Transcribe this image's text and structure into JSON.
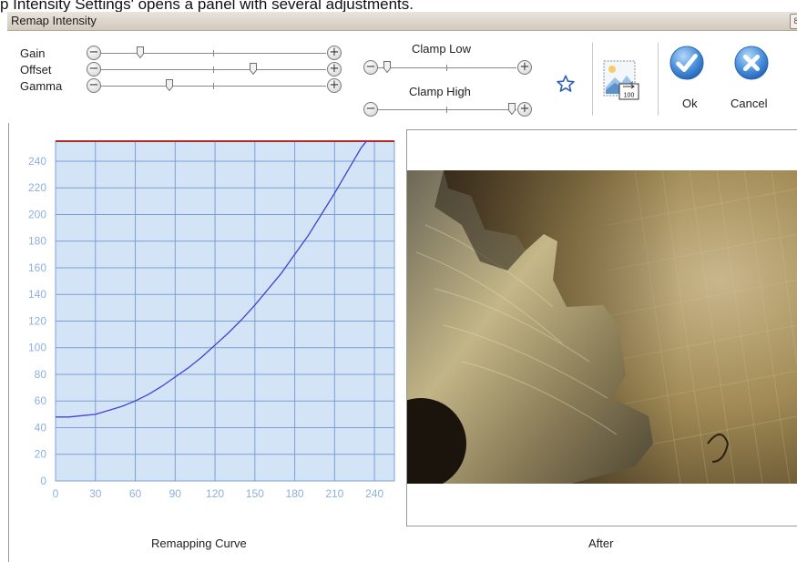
{
  "caption": "p Intensity Settings' opens a panel with several adjustments.",
  "window": {
    "title": "Remap Intensity",
    "close_glyph": "8"
  },
  "sliders": {
    "gain": {
      "label": "Gain",
      "value": 0.17
    },
    "offset": {
      "label": "Offset",
      "value": 0.68
    },
    "gamma": {
      "label": "Gamma",
      "value": 0.3
    },
    "clamp_low": {
      "label": "Clamp Low",
      "value": 0.04
    },
    "clamp_high": {
      "label": "Clamp High",
      "value": 0.98
    }
  },
  "buttons": {
    "ok": {
      "label": "Ok"
    },
    "cancel": {
      "label": "Cancel"
    },
    "preview_icon_text": "100"
  },
  "icons": {
    "favorite": "star-icon",
    "preview": "image-preview-icon",
    "ok": "checkmark-icon",
    "cancel": "x-icon",
    "minus": "minus-icon",
    "plus": "plus-icon"
  },
  "glyphs": {
    "minus": "−",
    "plus": "+"
  },
  "colors": {
    "chart_bg": "#d4e4f7",
    "grid": "#7b9fd4",
    "curve": "#4a3fd0",
    "clamp_line": "#b5282a",
    "tick_label": "#8fb0df",
    "button_blue": "#3f86d8"
  },
  "chart_data": {
    "type": "line",
    "xlabel": "Remapping Curve",
    "x_ticks": [
      0,
      30,
      60,
      90,
      120,
      150,
      180,
      210,
      240
    ],
    "y_ticks": [
      0,
      20,
      40,
      60,
      80,
      100,
      120,
      140,
      160,
      180,
      200,
      220,
      240
    ],
    "xlim": [
      0,
      255
    ],
    "ylim": [
      0,
      255
    ],
    "grid": true,
    "series": [
      {
        "x": [
          0,
          10,
          20,
          30,
          40,
          50,
          60,
          70,
          80,
          90,
          100,
          110,
          120,
          130,
          140,
          150,
          160,
          170,
          180,
          190,
          200,
          210,
          220,
          230,
          234
        ],
        "y": [
          48,
          48,
          49,
          50,
          53,
          56,
          60,
          65,
          71,
          78,
          85,
          93,
          102,
          111,
          121,
          132,
          144,
          156,
          170,
          184,
          200,
          216,
          233,
          250,
          255
        ]
      }
    ],
    "clamp_high_y": 255
  },
  "after_label": "After"
}
